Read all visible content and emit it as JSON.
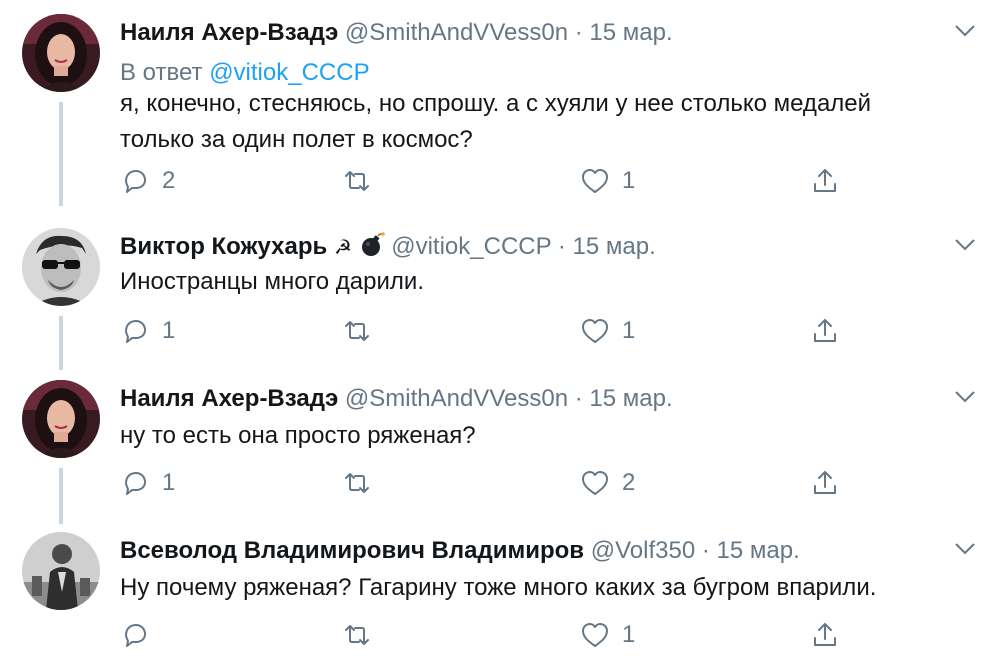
{
  "tweets": [
    {
      "name": "Наиля Ахер-Взадэ",
      "handle": "@SmithAndVVess0n",
      "date": "15 мар.",
      "reply_prefix": "В ответ",
      "reply_to": "@vitiok_CCCP",
      "text_lines": [
        "я, конечно, стесняюсь, но спрошу. а с хуяли у нее столько медалей",
        "только за один полет в космос?"
      ],
      "replies": "2",
      "retweets": "",
      "likes": "1"
    },
    {
      "name": "Виктор Кожухарь",
      "emoji": "☭",
      "handle": "@vitiok_CCCP",
      "date": "15 мар.",
      "text_lines": [
        "Иностранцы много дарили."
      ],
      "replies": "1",
      "retweets": "",
      "likes": "1"
    },
    {
      "name": "Наиля Ахер-Взадэ",
      "handle": "@SmithAndVVess0n",
      "date": "15 мар.",
      "text_lines": [
        "ну то есть она просто ряженая?"
      ],
      "replies": "1",
      "retweets": "",
      "likes": "2"
    },
    {
      "name": "Всеволод Владимирович Владимиров",
      "handle": "@Volf350",
      "date": "15 мар.",
      "text_lines": [
        "Ну почему ряженая? Гагарину тоже много каких за бугром впарили."
      ],
      "replies": "",
      "retweets": "",
      "likes": "1"
    }
  ],
  "colors": {
    "text": "#14171a",
    "secondary": "#657786",
    "link": "#1da1f2",
    "thread_line": "#ccd6dd"
  },
  "icons": {
    "reply": "reply-icon",
    "retweet": "retweet-icon",
    "like": "heart-icon",
    "share": "share-icon",
    "menu": "chevron-down-icon"
  }
}
